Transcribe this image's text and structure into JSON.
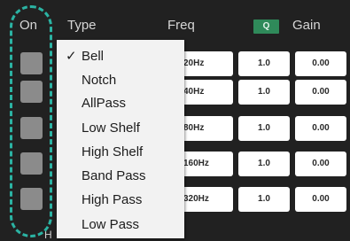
{
  "header": {
    "on": "On",
    "type": "Type",
    "freq": "Freq",
    "q": "Q",
    "gain": "Gain"
  },
  "colors": {
    "background": "#212121",
    "q_badge": "#2f8a5a",
    "toggle": "#8b8b8b",
    "highlight_dash": "#2bb3a3",
    "menu_bg": "#f2f2f2"
  },
  "rows": [
    {
      "freq": "20Hz",
      "q": "1.0",
      "gain": "0.00"
    },
    {
      "freq": "40Hz",
      "q": "1.0",
      "gain": "0.00"
    },
    {
      "freq": "80Hz",
      "q": "1.0",
      "gain": "0.00"
    },
    {
      "freq": "160Hz",
      "q": "1.0",
      "gain": "0.00"
    },
    {
      "freq": "320Hz",
      "q": "1.0",
      "gain": "0.00"
    }
  ],
  "type_menu": {
    "selected": "Bell",
    "items": [
      {
        "label": "Bell",
        "check": "✓"
      },
      {
        "label": "Notch",
        "check": ""
      },
      {
        "label": "AllPass",
        "check": ""
      },
      {
        "label": "Low Shelf",
        "check": ""
      },
      {
        "label": "High Shelf",
        "check": ""
      },
      {
        "label": "Band Pass",
        "check": ""
      },
      {
        "label": "High Pass",
        "check": ""
      },
      {
        "label": "Low Pass",
        "check": ""
      }
    ]
  },
  "bottom_hint": "H"
}
